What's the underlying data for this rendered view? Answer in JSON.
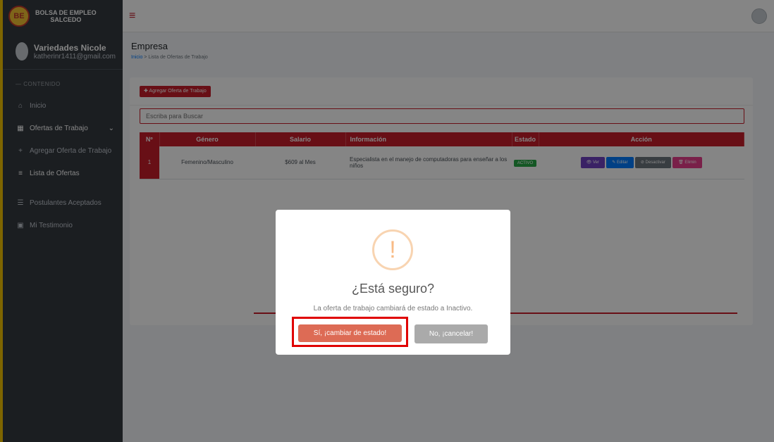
{
  "brand": {
    "line1": "BOLSA DE EMPLEO",
    "line2": "SALCEDO",
    "logo_text": "BE"
  },
  "header": {
    "menu_icon": "hamburger-icon"
  },
  "user": {
    "name": "Variedades Nicole",
    "email": "katherinr1411@gmail.com"
  },
  "sidebar": {
    "section_label": "— CONTENIDO",
    "items": [
      {
        "label": "Inicio",
        "icon": "home-icon"
      },
      {
        "label": "Ofertas de Trabajo",
        "icon": "table-icon"
      },
      {
        "label": "Agregar Oferta de Trabajo",
        "icon": "plus-icon"
      },
      {
        "label": "Lista de Ofertas",
        "icon": "list-icon"
      },
      {
        "label": "Postulantes Aceptados",
        "icon": "list-icon"
      },
      {
        "label": "Mi Testimonio",
        "icon": "comment-icon"
      }
    ]
  },
  "page": {
    "title": "Empresa",
    "breadcrumb": {
      "home": "Inicio",
      "separator": ">",
      "current": "Lista de Ofertas de Trabajo"
    }
  },
  "toolbar": {
    "add_label": "✚ Agregar Oferta de Trabajo"
  },
  "search": {
    "placeholder": "Escriba para Buscar"
  },
  "table": {
    "headers": [
      "Nº",
      "Género",
      "Salario",
      "Información",
      "Estado",
      "Acción"
    ],
    "rows": [
      {
        "num": "1",
        "genero": "Femenino/Masculino",
        "salario": "$609 al Mes",
        "informacion": "Especialista en el manejo de computadoras para enseñar a los niños",
        "estado": "ACTIVO",
        "acciones": {
          "ver": "👁 Ver",
          "editar": "✎ Editar",
          "desactivar": "⊘ Desactivar",
          "eliminar": "🗑 Elimin"
        }
      }
    ]
  },
  "modal": {
    "icon": "!",
    "title": "¿Está seguro?",
    "text": "La oferta de trabajo cambiará de estado a Inactivo.",
    "confirm_label": "Sí, ¡cambiar de estado!",
    "cancel_label": "No, ¡cancelar!"
  },
  "colors": {
    "primary": "#c81e2b",
    "sidebar": "#343a40",
    "confirm": "#dd6b55",
    "cancel": "#aaaaaa",
    "highlight": "#e00000"
  }
}
